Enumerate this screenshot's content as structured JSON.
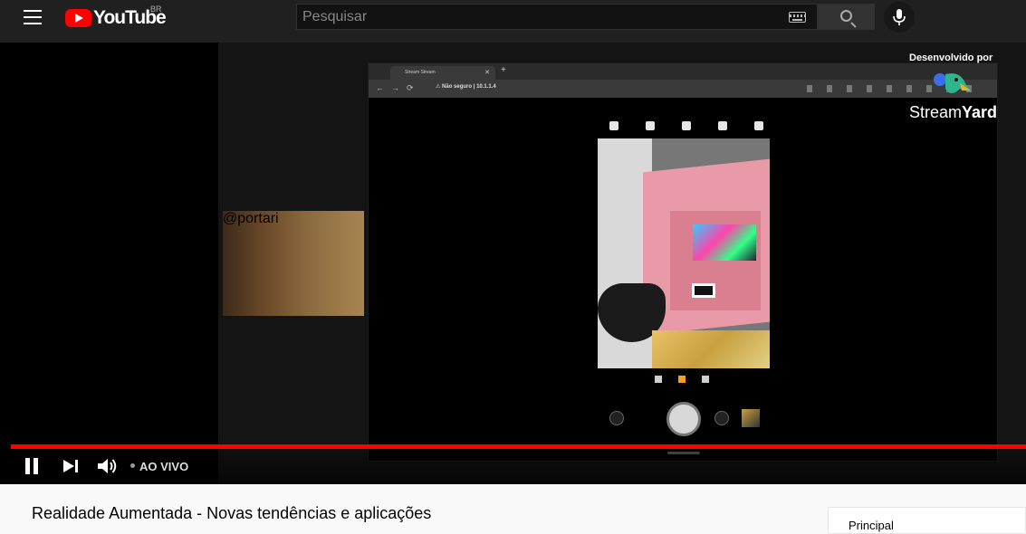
{
  "masthead": {
    "logo_text": "YouTube",
    "country_code": "BR",
    "search_placeholder": "Pesquisar"
  },
  "video": {
    "webcam_label": "@portari",
    "browser": {
      "tab_title": "Stream Stream",
      "url_warning": "Não seguro",
      "url": "10.1.1.4"
    },
    "overlay": {
      "developed_by": "Desenvolvido por",
      "brand_light": "Stream",
      "brand_bold": "Yard"
    }
  },
  "controls": {
    "live_label": "AO VIVO",
    "progress": 1.0
  },
  "below": {
    "title": "Realidade Aumentada - Novas tendências e aplicações",
    "side_card_text": "Principal"
  },
  "colors": {
    "brand_red": "#ff0000",
    "masthead_bg": "#202020",
    "page_bg": "#f9f9f9"
  }
}
